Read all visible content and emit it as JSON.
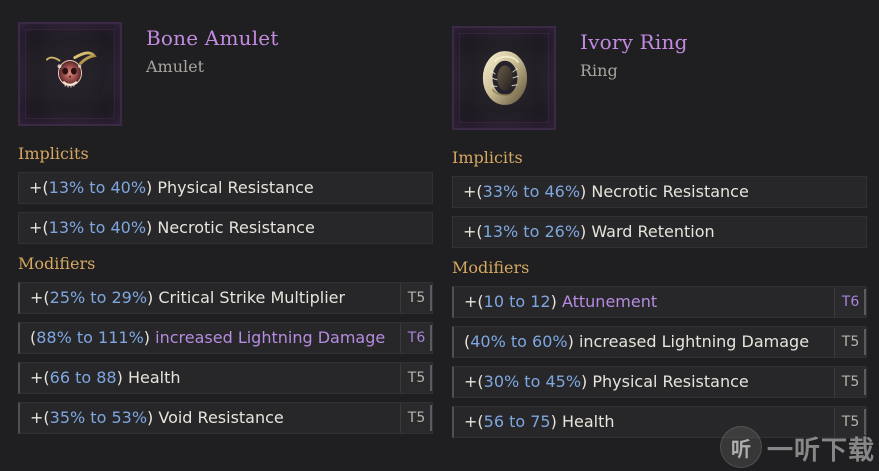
{
  "left_item": {
    "name": "Bone Amulet",
    "type": "Amulet",
    "icon": "amulet-icon",
    "sections": {
      "implicits_label": "Implicits",
      "modifiers_label": "Modifiers"
    },
    "implicits": [
      {
        "prefix": "+(",
        "range": "13% to 40%",
        "suffix": ")",
        "stat": "Physical Resistance"
      },
      {
        "prefix": "+(",
        "range": "13% to 40%",
        "suffix": ")",
        "stat": "Necrotic Resistance"
      }
    ],
    "modifiers": [
      {
        "prefix": "+(",
        "range": "25% to 29%",
        "suffix": ")",
        "stat": "Critical Strike Multiplier",
        "tier": "T5",
        "style": "normal"
      },
      {
        "prefix": "(",
        "range": "88% to 111%",
        "suffix": ")",
        "stat": "increased Lightning Damage",
        "tier": "T6",
        "style": "special"
      },
      {
        "prefix": "+(",
        "range": "66 to 88",
        "suffix": ")",
        "stat": "Health",
        "tier": "T5",
        "style": "normal"
      },
      {
        "prefix": "+(",
        "range": "35% to 53%",
        "suffix": ")",
        "stat": "Void Resistance",
        "tier": "T5",
        "style": "normal"
      }
    ]
  },
  "right_item": {
    "name": "Ivory Ring",
    "type": "Ring",
    "icon": "ring-icon",
    "sections": {
      "implicits_label": "Implicits",
      "modifiers_label": "Modifiers"
    },
    "implicits": [
      {
        "prefix": "+(",
        "range": "33% to 46%",
        "suffix": ")",
        "stat": "Necrotic Resistance"
      },
      {
        "prefix": "+(",
        "range": "13% to 26%",
        "suffix": ")",
        "stat": "Ward Retention"
      }
    ],
    "modifiers": [
      {
        "prefix": "+(",
        "range": "10 to 12",
        "suffix": ")",
        "stat": "Attunement",
        "tier": "T6",
        "style": "special"
      },
      {
        "prefix": "(",
        "range": "40% to 60%",
        "suffix": ")",
        "stat": "increased Lightning Damage",
        "tier": "T5",
        "style": "normal"
      },
      {
        "prefix": "+(",
        "range": "30% to 45%",
        "suffix": ")",
        "stat": "Physical Resistance",
        "tier": "T5",
        "style": "normal"
      },
      {
        "prefix": "+(",
        "range": "56 to 75",
        "suffix": ")",
        "stat": "Health",
        "tier": "T5",
        "style": "normal"
      }
    ]
  },
  "watermark": {
    "logo_text": "听",
    "brand_text": "一听下载"
  },
  "colors": {
    "background": "#1f1f21",
    "item_name": "#c28be0",
    "section_title": "#d5a761",
    "range": "#7ea6df",
    "special_stat": "#b68be0"
  }
}
